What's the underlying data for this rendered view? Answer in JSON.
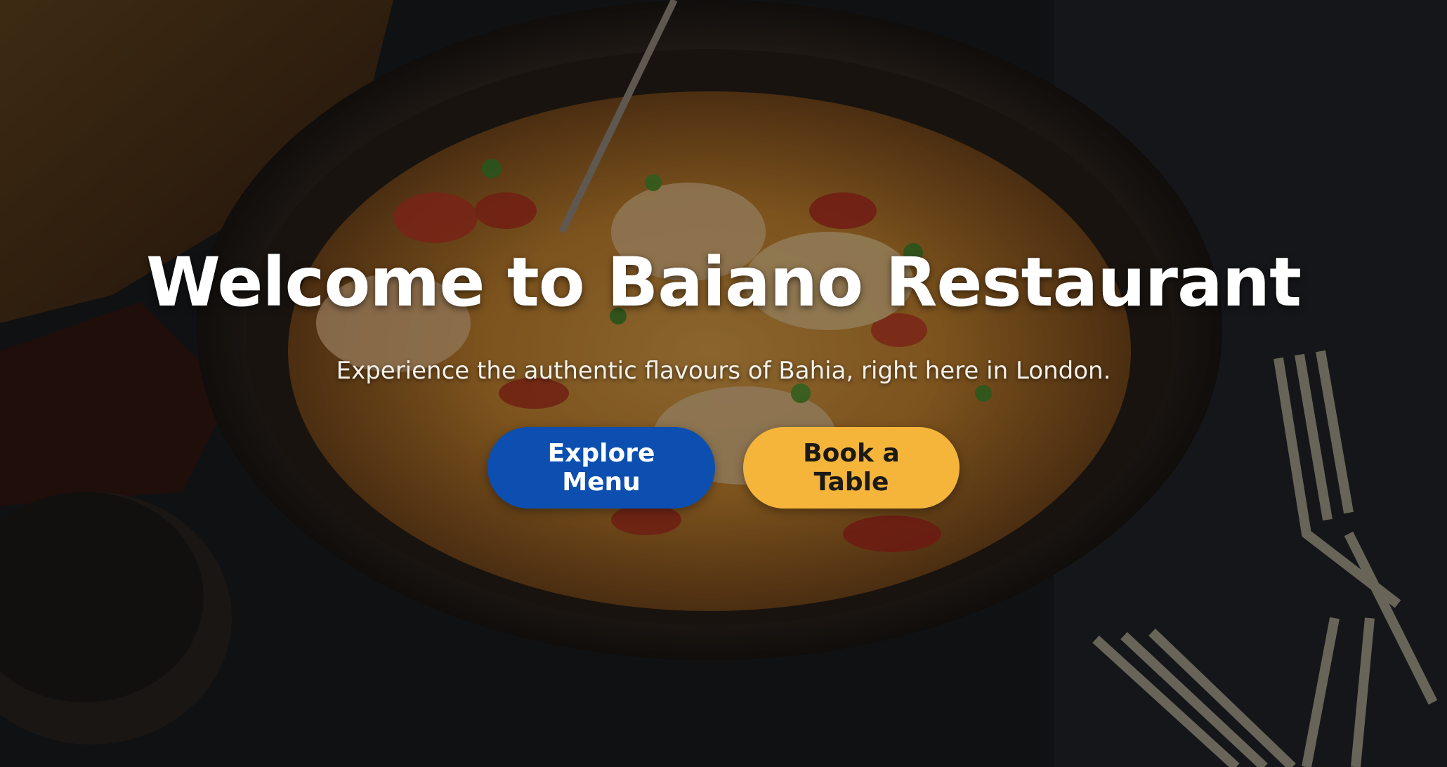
{
  "hero": {
    "title": "Welcome to Baiano Restaurant",
    "subtitle": "Experience the authentic flavours of Bahia, right here in London.",
    "background_image": "moqueca-bowl-dark-table"
  },
  "actions": {
    "primary_label": "Explore Menu",
    "secondary_label": "Book a Table"
  },
  "colors": {
    "primary_button": "#0c4fb0",
    "secondary_button": "#f4b53a",
    "title_text": "#ffffff"
  }
}
